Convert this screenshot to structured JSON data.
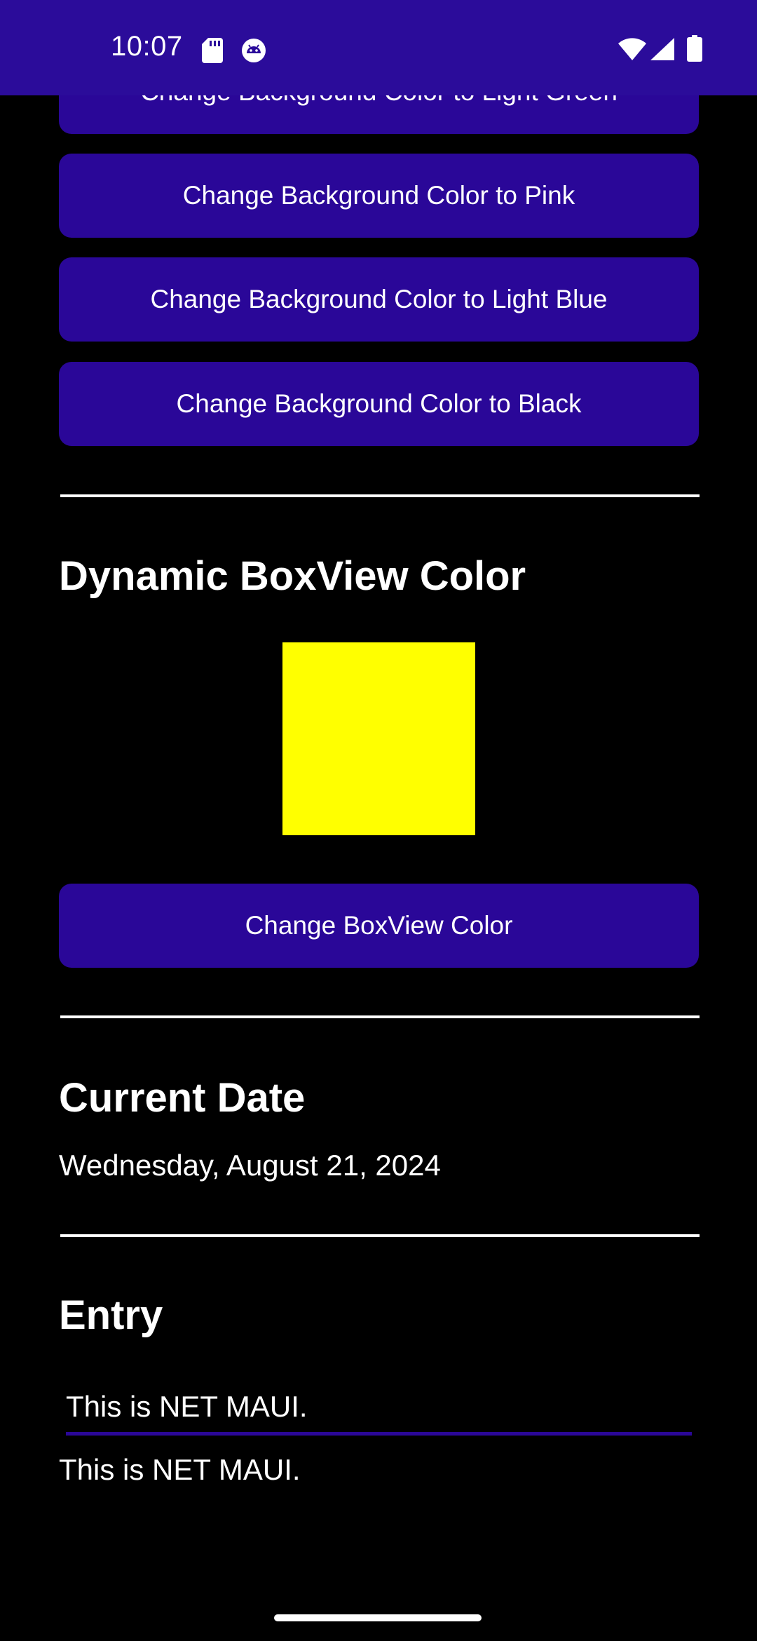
{
  "status_bar": {
    "time": "10:07",
    "color": "#2b0c9a",
    "left_icons": [
      "sd-card-icon",
      "android-debug-icon"
    ],
    "right_icons": [
      "wifi-icon",
      "cellular-signal-icon",
      "battery-icon"
    ]
  },
  "background_buttons": [
    {
      "label": "Change Background Color to Light Green"
    },
    {
      "label": "Change Background Color to Pink"
    },
    {
      "label": "Change Background Color to Light Blue"
    },
    {
      "label": "Change Background Color to Black"
    }
  ],
  "boxview_section": {
    "title": "Dynamic BoxView Color",
    "box_color": "#ffff00",
    "button_label": "Change BoxView Color"
  },
  "date_section": {
    "title": "Current Date",
    "value": "Wednesday, August 21, 2024"
  },
  "entry_section": {
    "title": "Entry",
    "input_value": "This is NET MAUI.",
    "echo_text": "This is NET MAUI."
  },
  "theme": {
    "accent": "#2a0798",
    "page_background": "#000000",
    "text": "#ffffff"
  }
}
